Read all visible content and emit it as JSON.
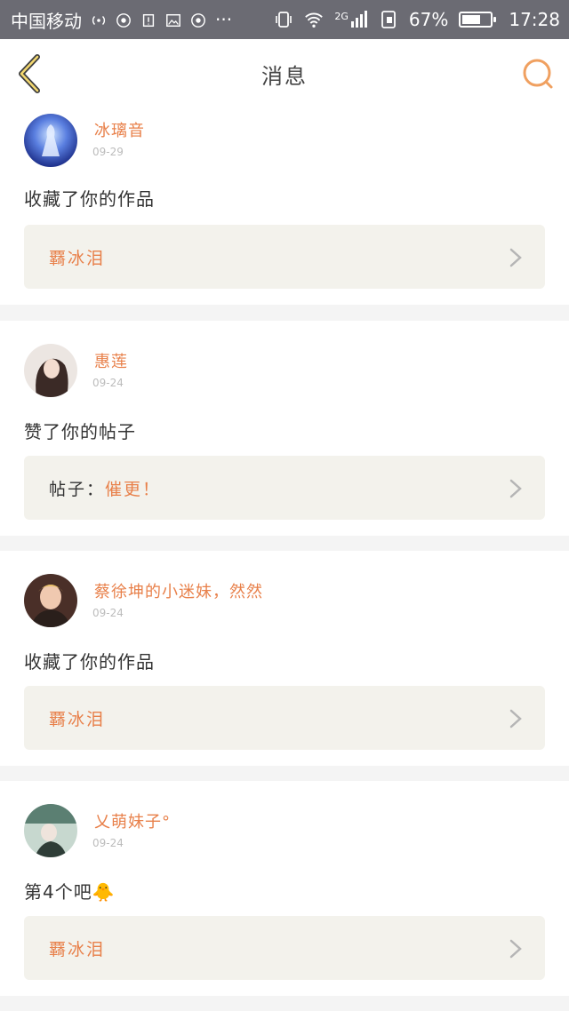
{
  "status_bar": {
    "carrier": "中国移动",
    "more": "···",
    "network": "2G",
    "battery": "67%",
    "battery_level": 0.67,
    "time": "17:28"
  },
  "header": {
    "title": "消息",
    "back_icon": "chevron-left-icon",
    "search_icon": "search-icon",
    "accent_color": "#f0a060"
  },
  "messages": [
    {
      "username": "冰璃音",
      "date": "09-29",
      "action": "收藏了你的作品",
      "ref_label": "",
      "ref_title": "覉冰泪"
    },
    {
      "username": "惠莲",
      "date": "09-24",
      "action": "赞了你的帖子",
      "ref_label": "帖子：",
      "ref_title": "催更！"
    },
    {
      "username": "蔡徐坤的小迷妹，然然",
      "date": "09-24",
      "action": "收藏了你的作品",
      "ref_label": "",
      "ref_title": "覉冰泪"
    },
    {
      "username": "乂萌妹子°",
      "date": "09-24",
      "action": "第4个吧🐥",
      "ref_label": "",
      "ref_title": "覉冰泪"
    }
  ]
}
